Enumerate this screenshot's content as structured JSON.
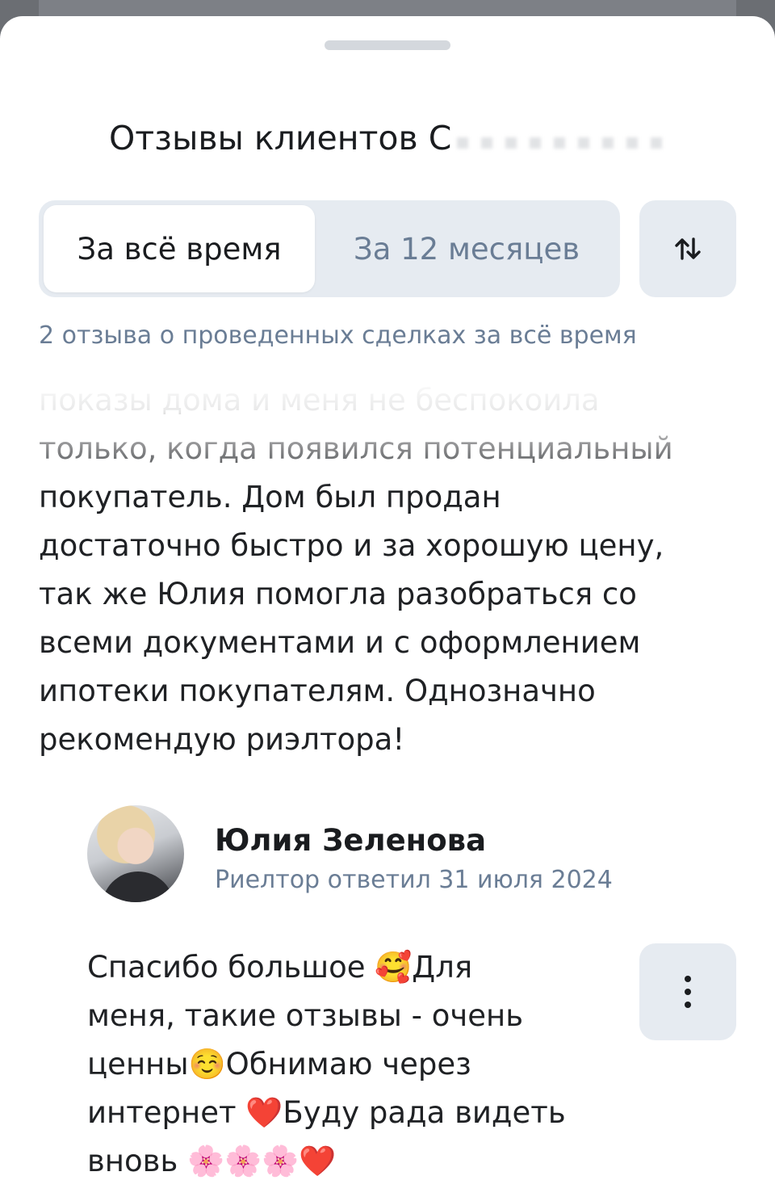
{
  "sheet": {
    "title": "Отзывы клиентов С"
  },
  "tabs": [
    {
      "label": "За всё время",
      "selected": true
    },
    {
      "label": "За 12 месяцев",
      "selected": false
    }
  ],
  "sort_icon": "sort-arrows-icon",
  "summary": "2 отзыва о проведенных сделках за всё время",
  "review": {
    "lines": [
      "показы дома и меня не беспокоила",
      "только, когда появился потенциальный",
      "покупатель. Дом был продан",
      "достаточно быстро и за хорошую цену,",
      "так же Юлия помогла разобраться со",
      "всеми документами и с оформлением",
      "ипотеки покупателям. Однозначно",
      "рекомендую риэлтора!"
    ]
  },
  "reply": {
    "author": "Юлия Зеленова",
    "meta": "Риелтор ответил 31 июля 2024",
    "lines": [
      "Спасибо большое 🥰Для",
      "меня, такие отзывы - очень",
      "ценны☺️Обнимаю через",
      "интернет ❤️Буду рада видеть",
      "вновь 🌸🌸🌸❤️"
    ],
    "more_icon": "more-vertical-icon"
  },
  "colors": {
    "accent_muted": "#6a7d95",
    "segment_bg": "#e6ebf1",
    "text_primary": "#1a1c1f"
  }
}
